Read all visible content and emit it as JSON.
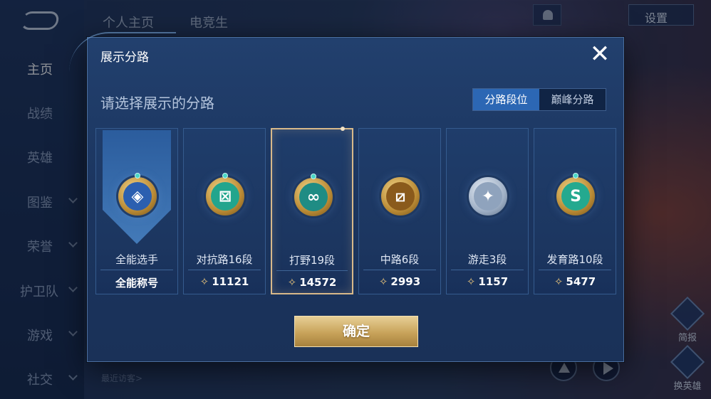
{
  "background": {
    "nav": [
      {
        "label": "主页",
        "active": true,
        "arrow": false
      },
      {
        "label": "战绩",
        "active": false,
        "arrow": false
      },
      {
        "label": "英雄",
        "active": false,
        "arrow": false
      },
      {
        "label": "图鉴",
        "active": false,
        "arrow": true
      },
      {
        "label": "荣誉",
        "active": false,
        "arrow": true
      },
      {
        "label": "护卫队",
        "active": false,
        "arrow": true
      },
      {
        "label": "游戏",
        "active": false,
        "arrow": true
      },
      {
        "label": "社交",
        "active": false,
        "arrow": true
      }
    ],
    "top_tabs": [
      "个人主页",
      "电竞生"
    ],
    "settings_label": "设置",
    "recent_visitors_label": "最近访客>",
    "side_buttons": [
      "简报",
      "换英雄"
    ]
  },
  "modal": {
    "title": "展示分路",
    "close_icon": "close-icon",
    "subtitle": "请选择展示的分路",
    "segments": [
      {
        "label": "分路段位",
        "active": true
      },
      {
        "label": "巅峰分路",
        "active": false
      }
    ],
    "cards": [
      {
        "label": "全能选手",
        "footer": "全能称号",
        "points": null,
        "icon": "all-round-badge-icon",
        "glyph": "◈",
        "color": "#2b5fb0",
        "selected": false,
        "banner": true
      },
      {
        "label": "对抗路16段",
        "footer": null,
        "points": "11121",
        "icon": "clash-lane-badge-icon",
        "glyph": "⊠",
        "color": "#22a58d",
        "selected": false,
        "banner": false
      },
      {
        "label": "打野19段",
        "footer": null,
        "points": "14572",
        "icon": "jungle-badge-icon",
        "glyph": "∞",
        "color": "#1f8c84",
        "selected": true,
        "banner": false
      },
      {
        "label": "中路6段",
        "footer": null,
        "points": "2993",
        "icon": "mid-lane-badge-icon",
        "glyph": "⧄",
        "color": "#8a5a1c",
        "selected": false,
        "banner": false
      },
      {
        "label": "游走3段",
        "footer": null,
        "points": "1157",
        "icon": "roam-badge-icon",
        "glyph": "✦",
        "color": "#8fa3bd",
        "selected": false,
        "banner": false
      },
      {
        "label": "发育路10段",
        "footer": null,
        "points": "5477",
        "icon": "farm-lane-badge-icon",
        "glyph": "S",
        "color": "#24a98f",
        "selected": false,
        "banner": false
      }
    ],
    "points_icon": "points-icon",
    "confirm_label": "确定"
  }
}
